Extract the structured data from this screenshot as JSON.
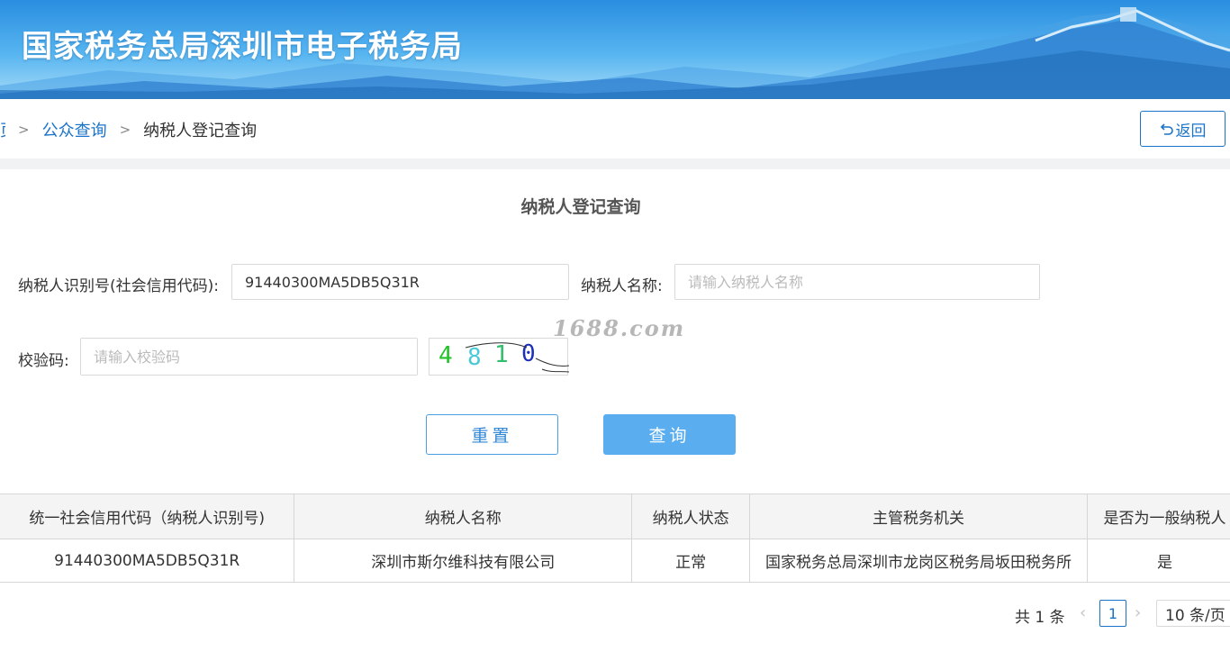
{
  "banner": {
    "title": "国家税务总局深圳市电子税务局"
  },
  "breadcrumb": {
    "home_label": "页",
    "items": [
      {
        "label": "公众查询"
      },
      {
        "label": "纳税人登记查询"
      }
    ],
    "separator": ">"
  },
  "back_button": {
    "label": "返回",
    "icon": "undo-arrow-icon"
  },
  "form": {
    "title": "纳税人登记查询",
    "taxpayer_id_label": "纳税人识别号(社会信用代码):",
    "taxpayer_id_value": "91440300MA5DB5Q31R",
    "taxpayer_name_label": "纳税人名称:",
    "taxpayer_name_placeholder": "请输入纳税人名称",
    "captcha_label": "校验码:",
    "captcha_placeholder": "请输入校验码",
    "captcha_text": "4810",
    "watermark": "1688.com",
    "reset_label": "重置",
    "query_label": "查询"
  },
  "table": {
    "headers": [
      "统一社会信用代码（纳税人识别号)",
      "纳税人名称",
      "纳税人状态",
      "主管税务机关",
      "是否为一般纳税人"
    ],
    "rows": [
      [
        "91440300MA5DB5Q31R",
        "深圳市斯尔维科技有限公司",
        "正常",
        "国家税务总局深圳市龙岗区税务局坂田税务所",
        "是"
      ]
    ]
  },
  "pagination": {
    "total": "共 1 条",
    "current_page": "1",
    "page_size": "10 条/页"
  },
  "colors": {
    "accent": "#1a73c8",
    "query_button": "#5aaef0",
    "banner_top": "#2a8ee0"
  }
}
